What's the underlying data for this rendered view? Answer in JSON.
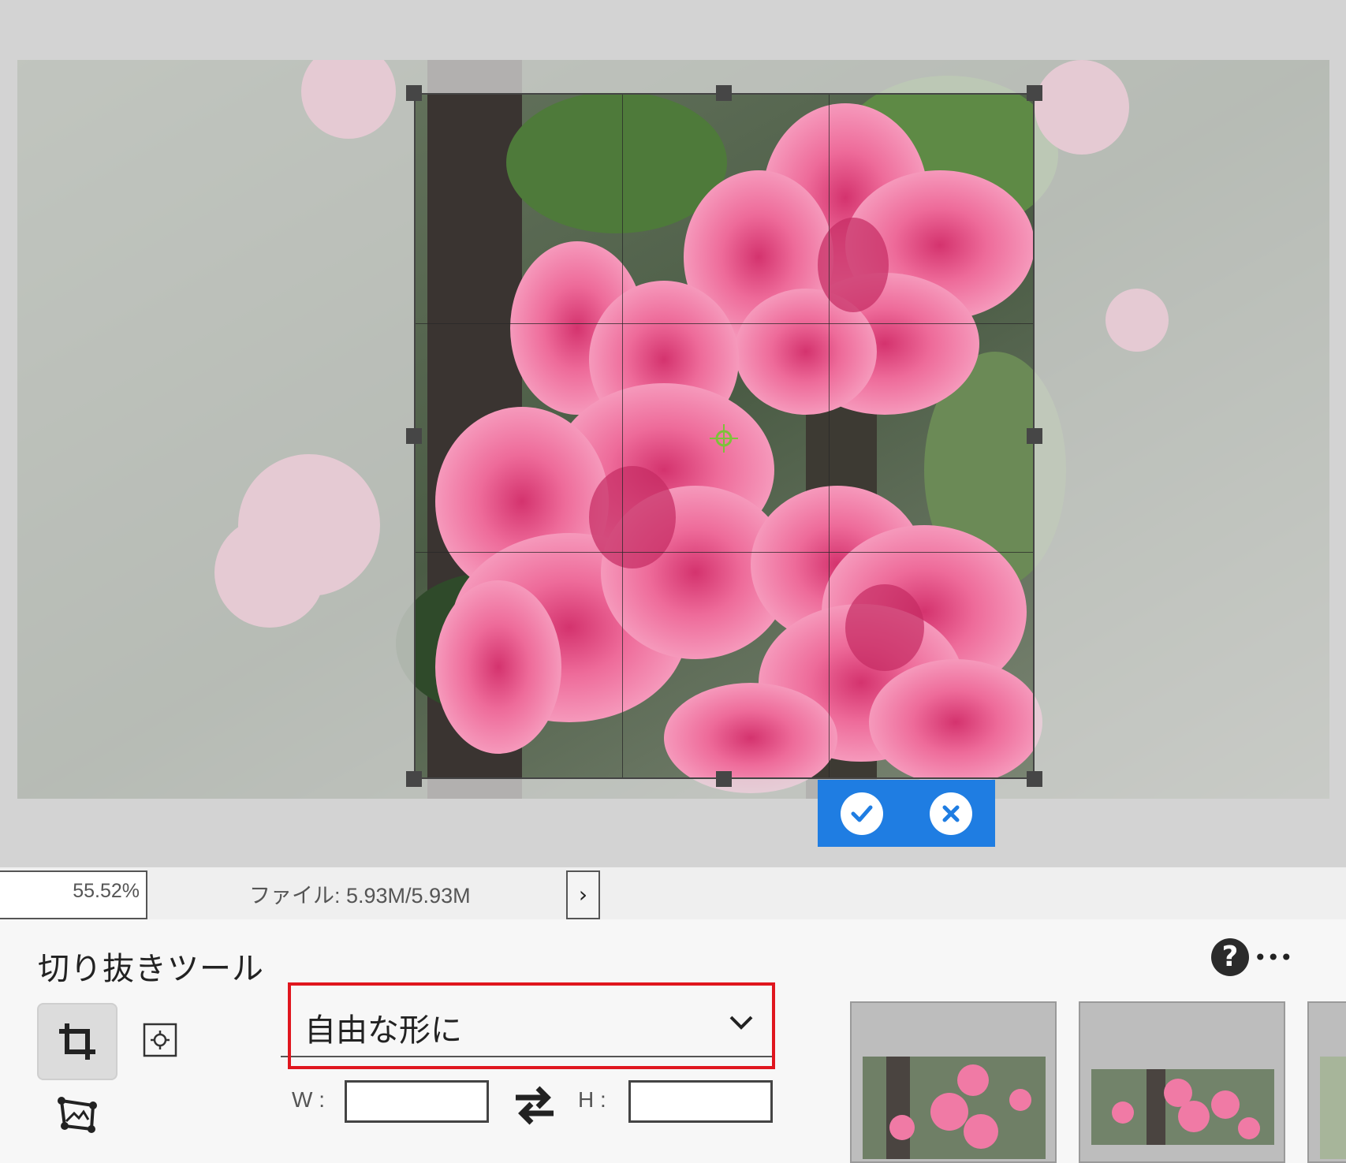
{
  "canvas": {
    "crop_overlay": "rule-of-thirds-grid",
    "confirm_icon": "checkmark-icon",
    "cancel_icon": "close-icon"
  },
  "statusbar": {
    "zoom": "55.52%",
    "file_info": "ファイル: 5.93M/5.93M",
    "expand_icon": "chevron-right-icon"
  },
  "tool_panel": {
    "title": "切り抜きツール",
    "help_icon": "question-icon",
    "help_suffix": "•••",
    "ratio_dropdown": {
      "selected": "自由な形に"
    },
    "width_label": "W :",
    "height_label": "H :",
    "width_value": "",
    "height_value": "",
    "swap_icon": "swap-arrows-icon",
    "presets": [
      "preset-crop-1",
      "preset-crop-2",
      "preset-crop-3"
    ]
  },
  "colors": {
    "accent": "#1f7de2",
    "highlight": "#e0161e",
    "petal": "#f06c9b"
  }
}
